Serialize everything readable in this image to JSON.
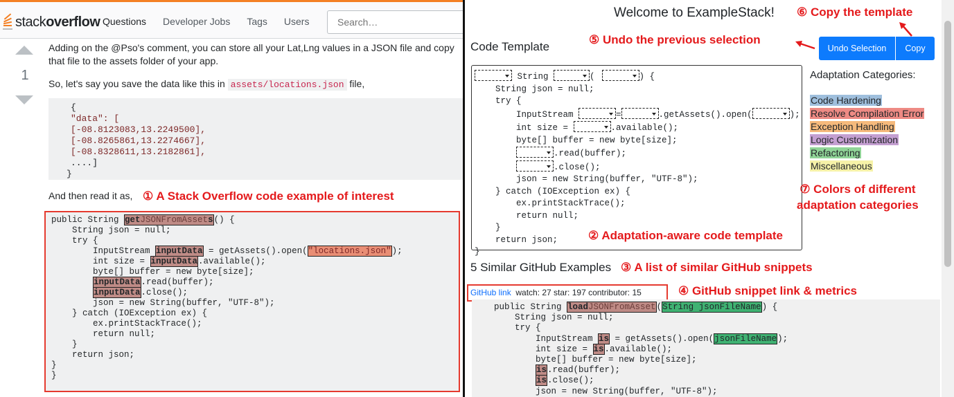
{
  "stackoverflow": {
    "logo_prefix": "stack",
    "logo_bold": "overflow",
    "nav": [
      "Questions",
      "Developer Jobs",
      "Tags",
      "Users"
    ],
    "search_placeholder": "Search…",
    "vote_count": "1",
    "paragraph1_line1": "Adding on the @Pso's comment, you can store all your Lat,Lng values in a JSON file and copy",
    "paragraph1_line2": "that file to the assets folder of your app.",
    "paragraph2_before": "So, let's say you save the data like this in ",
    "paragraph2_code": "assets/locations.json",
    "paragraph2_after": " file,",
    "json_lines": [
      "{",
      "\"data\": [",
      "[-08.8123083,13.2249500],",
      "[-08.8265861,13.2274667],",
      "[-08.8328611,13.2182861],",
      "....]",
      "}"
    ],
    "paragraph3": "And then read it as,",
    "code": {
      "l1_a": "public String ",
      "l1_hl_bold": "get",
      "l1_hl_plain": "JSONFromAsset",
      "l1_hl_end": "s",
      "l1_b": "() {",
      "l2": "    String json = null;",
      "l3": "    try {",
      "l4_a": "        InputStream ",
      "l4_var": "inputData",
      "l4_b": " = getAssets().open(",
      "l4_str": "\"locations.json\"",
      "l4_c": ");",
      "l5_a": "        int size = ",
      "l5_var": "inputData",
      "l5_b": ".available();",
      "l6": "        byte[] buffer = new byte[size];",
      "l7_a": "        ",
      "l7_var": "inputData",
      "l7_b": ".read(buffer);",
      "l8_a": "        ",
      "l8_var": "inputData",
      "l8_b": ".close();",
      "l9": "        json = new String(buffer, \"UTF-8\");",
      "l10": "    } catch (IOException ex) {",
      "l11": "        ex.printStackTrace();",
      "l12": "        return null;",
      "l13": "    }",
      "l14": "    return json;",
      "l15": "}",
      "l16": "}"
    }
  },
  "examplestack": {
    "welcome": "Welcome to ExampleStack!",
    "code_template_label": "Code Template",
    "undo_button": "Undo Selection",
    "copy_button": "Copy",
    "template": {
      "l1": " String ",
      "l1_b": "(",
      "l1_c": ") {",
      "l2": "    String json = null;",
      "l3": "    try {",
      "l4_a": "        InputStream ",
      "l4_b": "=",
      "l4_c": ".getAssets().open(",
      "l4_d": ");",
      "l5_a": "        int size = ",
      "l5_b": ".available();",
      "l6": "        byte[] buffer = new byte[size];",
      "l7_b": ".read(buffer);",
      "l8_b": ".close();",
      "l9": "        json = new String(buffer, \"UTF-8\");",
      "l10": "    } catch (IOException ex) {",
      "l11": "        ex.printStackTrace();",
      "l12": "        return null;",
      "l13": "    }",
      "l14": "    return json;",
      "l15": "}"
    },
    "categories_title": "Adaptation Categories:",
    "categories": [
      {
        "label": "Code Hardening",
        "color": "#9fbfdd"
      },
      {
        "label": "Resolve Compilation Error",
        "color": "#ee8a84"
      },
      {
        "label": "Exception Handling",
        "color": "#f6ba7c"
      },
      {
        "label": "Logic Customization",
        "color": "#c49fd1"
      },
      {
        "label": "Refactoring",
        "color": "#90d497"
      },
      {
        "label": "Miscellaneous",
        "color": "#f6f2a8"
      }
    ],
    "similar_title": "5 Similar GitHub Examples",
    "github_link": "GitHub link",
    "github_metrics": "watch: 27  star: 197  contributor: 15",
    "gh_code": {
      "l1_a": "public String ",
      "l1_bold": "load",
      "l1_plain": "JSONFromAsset",
      "l1_b": "(",
      "l1_param": "String jsonFileName",
      "l1_c": ") {",
      "l2": "    String json = null;",
      "l3": "    try {",
      "l4_a": "        InputStream ",
      "l4_var": "is",
      "l4_b": " = getAssets().open(",
      "l4_param": "jsonFileName",
      "l4_c": ");",
      "l5_a": "        int size = ",
      "l5_var": "is",
      "l5_b": ".available();",
      "l6": "        byte[] buffer = new byte[size];",
      "l7_a": "        ",
      "l7_var": "is",
      "l7_b": ".read(buffer);",
      "l8_a": "        ",
      "l8_var": "is",
      "l8_b": ".close();",
      "l9": "        json = new String(buffer, \"UTF-8\");"
    }
  },
  "annotations": {
    "a1": "① A Stack Overflow code example of interest",
    "a2": "② Adaptation-aware code template",
    "a3": "③ A list of similar GitHub snippets",
    "a4": "④ GitHub snippet link & metrics",
    "a5": "⑤ Undo the previous selection",
    "a6": "⑥ Copy the template",
    "a7_line1": "⑦ Colors of different",
    "a7_line2": "adaptation categories"
  },
  "colors": {
    "annotation_red": "#e41a1c",
    "so_orange": "#f48024",
    "button_blue": "#0d7bfd"
  }
}
